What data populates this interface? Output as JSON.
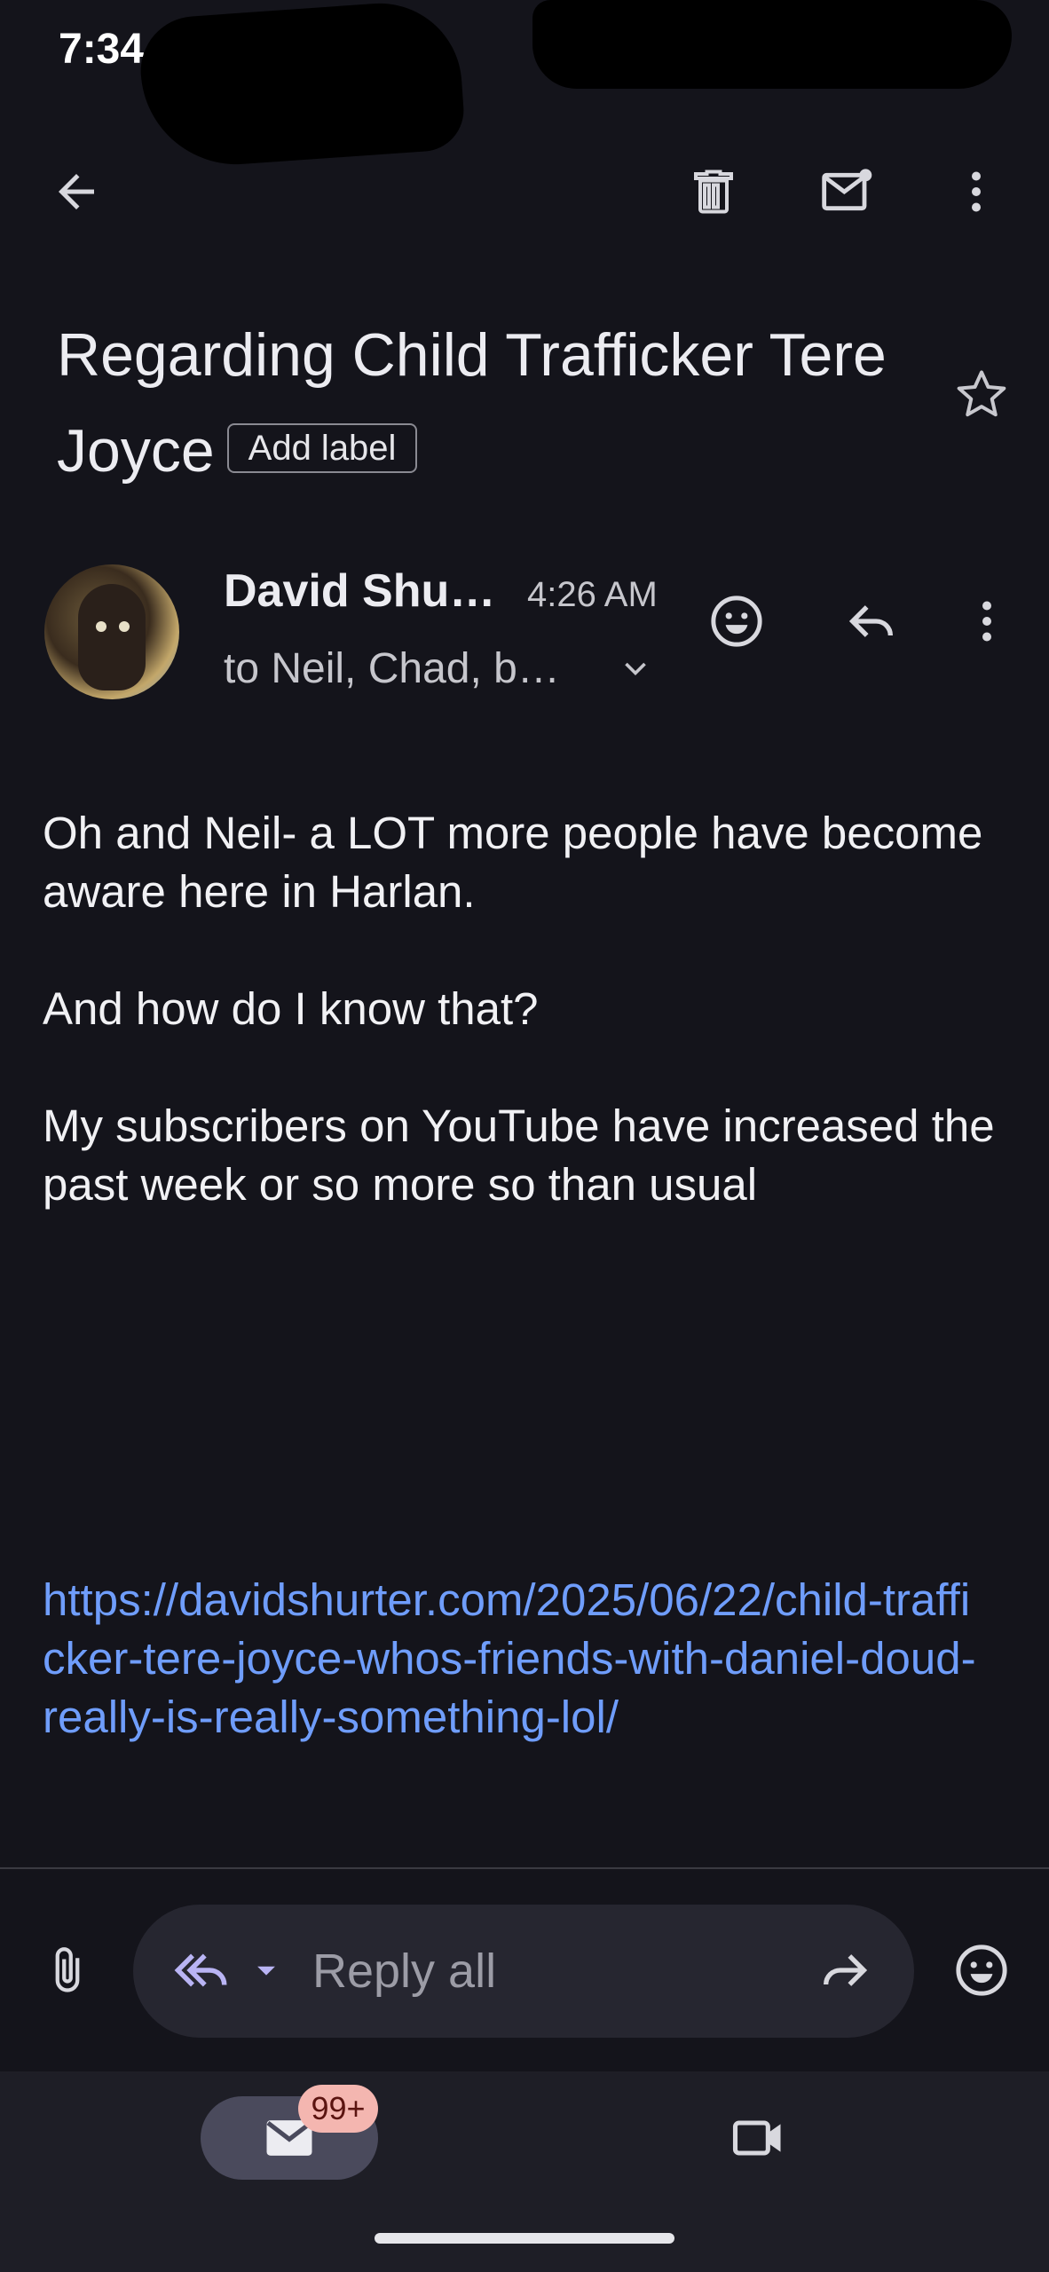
{
  "status_bar": {
    "time": "7:34"
  },
  "subject": {
    "text": "Regarding Child Trafficker Tere Joyce",
    "label_button": "Add label"
  },
  "message": {
    "sender": "David Shu…",
    "time": "4:26 AM",
    "recipients": "to Neil, Chad, b…",
    "body": [
      "Oh and Neil- a LOT more people have become aware here in Harlan.",
      "And how do I know that?",
      "My subscribers on YouTube have increased the past week or so more so than usual"
    ],
    "link": "https://davidshurter.com/2025/06/22/child-trafficker-tere-joyce-whos-friends-with-daniel-doud-really-is-really-something-lol/"
  },
  "reply_bar": {
    "placeholder": "Reply all"
  },
  "bottom_nav": {
    "mail_badge": "99+"
  },
  "icons": [
    "back-icon",
    "trash-icon",
    "mark-unread-icon",
    "more-vert-icon",
    "star-icon",
    "emoji-icon",
    "reply-icon",
    "chevron-down-icon",
    "attach-icon",
    "reply-all-icon",
    "forward-icon",
    "mail-icon",
    "video-icon"
  ],
  "colors": {
    "background": "#14141b",
    "link": "#6f9dfb",
    "badge": "#f4b6b0",
    "nav_pill": "#4a4a5c"
  }
}
